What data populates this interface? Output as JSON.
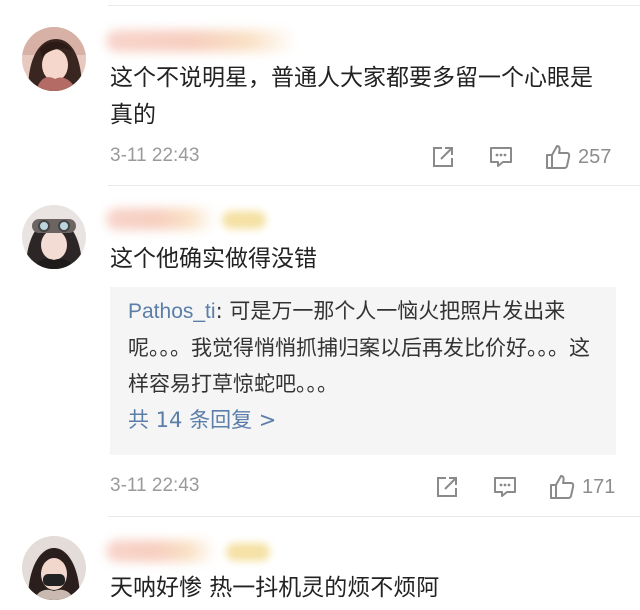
{
  "comments": [
    {
      "text": "这个不说明星，普通人大家都要多留一个心眼是真的",
      "timestamp": "3-11 22:43",
      "likes": "257",
      "icons": [
        "share-icon",
        "comment-icon",
        "like-icon"
      ]
    },
    {
      "text": "这个他确实做得没错",
      "reply": {
        "user": "Pathos_ti",
        "text": ": 可是万一那个人一恼火把照片发出来呢。。。我觉得悄悄抓捕归案以后再发比价好。。。这样容易打草惊蛇吧。。。",
        "more_label": "共 14 条回复 >"
      },
      "timestamp": "3-11 22:43",
      "likes": "171"
    },
    {
      "text": "天呐好惨 热一抖机灵的烦不烦阿"
    }
  ],
  "colors": {
    "link": "#5b7ea8",
    "text": "#222222",
    "meta": "#9a9a9a",
    "reply_bg": "#f5f5f5"
  }
}
